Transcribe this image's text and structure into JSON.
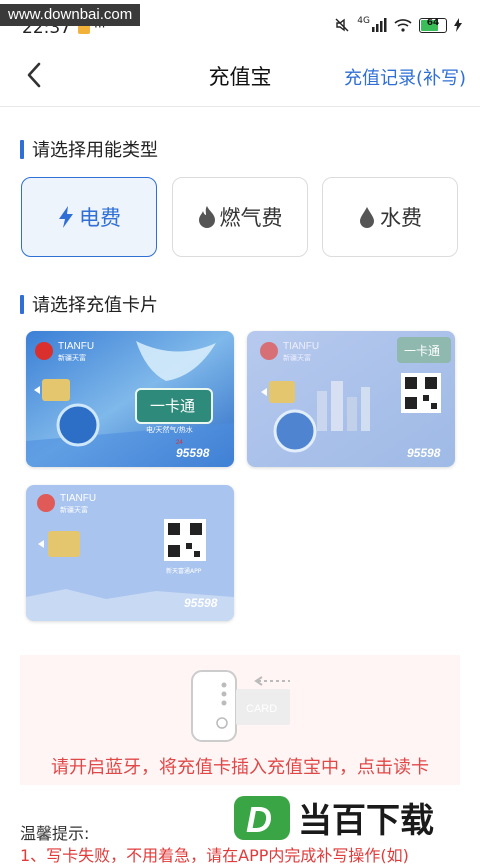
{
  "status": {
    "watermark": "www.downbai.com",
    "time": "22:37",
    "battery": "64",
    "network": "4G"
  },
  "header": {
    "title": "充值宝",
    "records": "充值记录(补写)"
  },
  "energy": {
    "section_title": "请选择用能类型",
    "types": [
      {
        "label": "电费",
        "icon": "lightning-icon",
        "selected": true
      },
      {
        "label": "燃气费",
        "icon": "flame-icon",
        "selected": false
      },
      {
        "label": "水费",
        "icon": "water-drop-icon",
        "selected": false
      }
    ]
  },
  "cards": {
    "section_title": "请选择充值卡片",
    "brand": "TIANFU",
    "brand_cn": "新疆天富",
    "card1_title": "一卡通",
    "card1_sub": "电/天然气/热水",
    "hotline": "95598",
    "hotline_tag": "24",
    "card2_title": "一卡通",
    "qr_caption": "新天富通APP"
  },
  "bluetooth": {
    "card_label": "CARD",
    "message": "请开启蓝牙，将充值卡插入充值宝中，点击读卡"
  },
  "tips": {
    "title": "温馨提示:",
    "item1": "1、写卡失败，不用着急，请在APP内完成补写操作(如)"
  },
  "watermark_logo": {
    "text": "当百下载",
    "letter": "D"
  },
  "colors": {
    "accent": "#2f6fd6",
    "alert": "#e04848"
  }
}
